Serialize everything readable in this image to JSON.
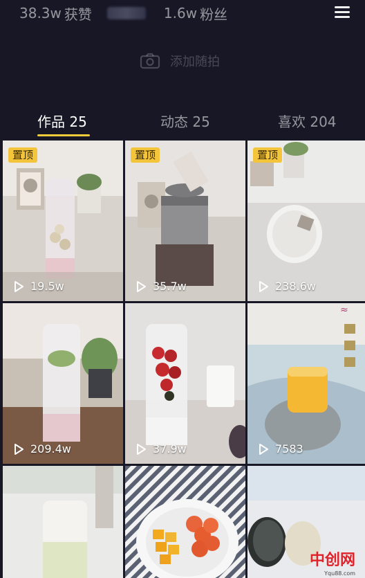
{
  "profile": {
    "likes_count": "38.3w",
    "likes_label": "获赞",
    "fans_count": "1.6w",
    "fans_label": "粉丝"
  },
  "add_snapshot_label": "添加随拍",
  "tabs": [
    {
      "label": "作品 25",
      "active": true
    },
    {
      "label": "动态 25",
      "active": false
    },
    {
      "label": "喜欢 204",
      "active": false
    }
  ],
  "pinned_label": "置顶",
  "videos": [
    {
      "plays": "19.5w",
      "pinned": true
    },
    {
      "plays": "35.7w",
      "pinned": true
    },
    {
      "plays": "238.6w",
      "pinned": true
    },
    {
      "plays": "209.4w",
      "pinned": false
    },
    {
      "plays": "37.9w",
      "pinned": false
    },
    {
      "plays": "7583",
      "pinned": false
    },
    {
      "plays": "",
      "pinned": false
    },
    {
      "plays": "",
      "pinned": false
    },
    {
      "plays": "",
      "pinned": false
    }
  ],
  "watermark": {
    "text": "中创网",
    "sub": "Yqu88.com"
  },
  "colors": {
    "background": "#171726",
    "pin_badge": "#f4c53a",
    "tab_indicator": "#f3cc3a"
  }
}
